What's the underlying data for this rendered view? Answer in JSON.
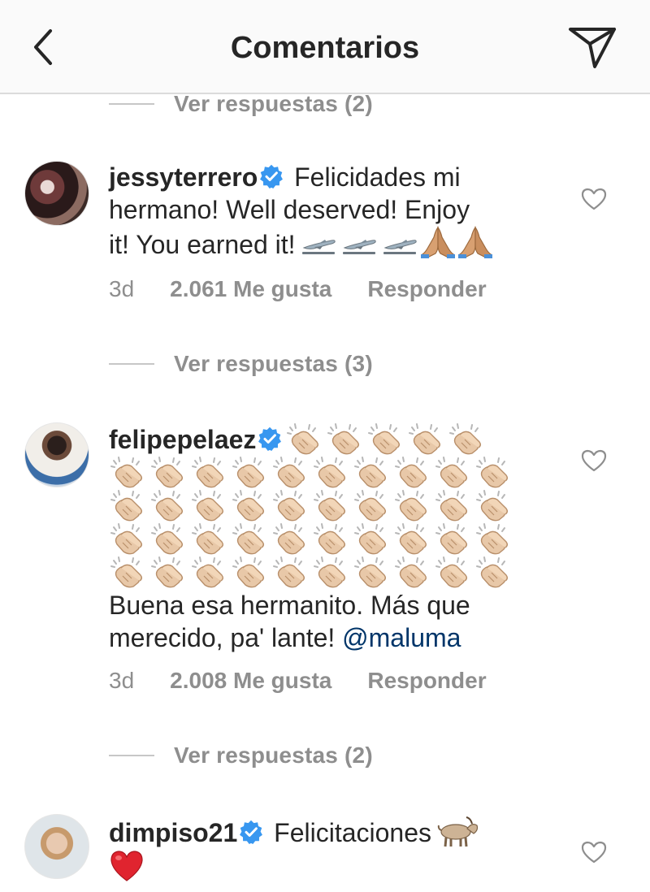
{
  "header": {
    "title": "Comentarios",
    "back_icon": "chevron-left-icon",
    "action_icon": "direct-send-icon"
  },
  "replies_toggles": [
    {
      "label": "Ver respuestas (2)"
    },
    {
      "label": "Ver respuestas (3)"
    },
    {
      "label": "Ver respuestas (2)"
    }
  ],
  "comments": [
    {
      "username": "jessyterrero",
      "verified": true,
      "text_line1": "Felicidades mi",
      "text_line2": "hermano! Well deserved! Enjoy",
      "text_line3": "it! You earned it!",
      "emoji": [
        "airplane-departure",
        "airplane-departure",
        "airplane-departure",
        "folded-hands",
        "folded-hands"
      ],
      "time": "3d",
      "likes": "2.061 Me gusta",
      "reply": "Responder"
    },
    {
      "username": "felipepelaez",
      "verified": true,
      "emoji": "clapping-hands",
      "clap_count": 45,
      "text_line1": "Buena esa hermanito. Más que",
      "text_line2": "merecido, pa' lante!",
      "mention": "@maluma",
      "time": "3d",
      "likes": "2.008 Me gusta",
      "reply": "Responder"
    },
    {
      "username": "dimpiso21",
      "verified": true,
      "text_line1": "Felicitaciones",
      "emoji": [
        "goat",
        "red-heart"
      ]
    }
  ],
  "colors": {
    "text": "#262626",
    "secondary": "#8e8e8e",
    "verified": "#3897f0",
    "mention": "#003569",
    "header_bg": "#fafafa"
  }
}
